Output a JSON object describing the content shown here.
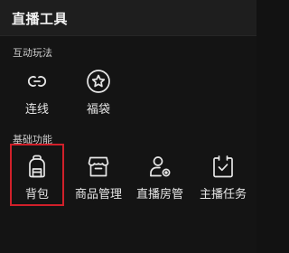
{
  "header": {
    "title": "直播工具"
  },
  "sections": [
    {
      "label": "互动玩法",
      "items": [
        {
          "label": "连线",
          "icon": "link-icon"
        },
        {
          "label": "福袋",
          "icon": "star-badge-icon"
        }
      ]
    },
    {
      "label": "基础功能",
      "items": [
        {
          "label": "背包",
          "icon": "backpack-icon"
        },
        {
          "label": "商品管理",
          "icon": "store-icon"
        },
        {
          "label": "直播房管",
          "icon": "user-settings-icon"
        },
        {
          "label": "主播任务",
          "icon": "task-check-icon"
        }
      ]
    }
  ],
  "colors": {
    "background": "#141414",
    "header_background": "#1e1e1e",
    "icon_stroke": "#e6e6e6",
    "highlight_border": "#d0202a"
  }
}
